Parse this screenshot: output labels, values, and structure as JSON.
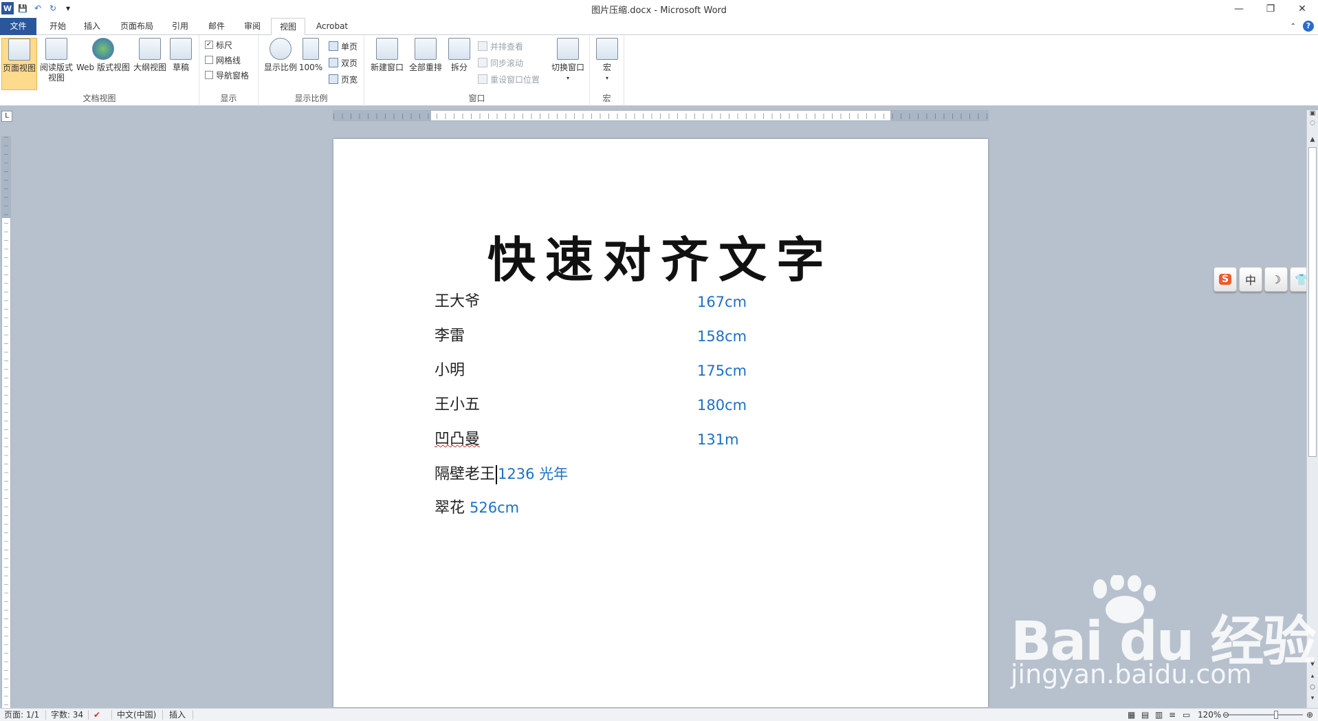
{
  "window": {
    "title": "图片压缩.docx - Microsoft Word",
    "minimize": "—",
    "restore": "❐",
    "close": "✕"
  },
  "qat": {
    "word_icon": "W",
    "save_icon": "💾",
    "undo_icon": "↶",
    "redo_icon": "↻",
    "customize_icon": "▾"
  },
  "tabs": [
    "文件",
    "开始",
    "插入",
    "页面布局",
    "引用",
    "邮件",
    "审阅",
    "视图",
    "Acrobat"
  ],
  "ribbon": {
    "doc_views": {
      "label": "文档视图",
      "print_layout": "页面视图",
      "full_screen_reading": "阅读版式\n视图",
      "web_layout": "Web 版式视图",
      "outline": "大纲视图",
      "draft": "草稿"
    },
    "show": {
      "label": "显示",
      "ruler": "标尺",
      "gridlines": "网格线",
      "nav_pane": "导航窗格"
    },
    "zoom": {
      "label": "显示比例",
      "zoom": "显示比例",
      "hundred": "100%",
      "one_page": "单页",
      "two_pages": "双页",
      "page_width": "页宽"
    },
    "window": {
      "label": "窗口",
      "new_window": "新建窗口",
      "arrange_all": "全部重排",
      "split": "拆分",
      "side_by_side": "并排查看",
      "sync_scroll": "同步滚动",
      "reset_position": "重设窗口位置",
      "switch_windows": "切换窗口"
    },
    "macros": {
      "label": "宏",
      "macros": "宏"
    }
  },
  "document": {
    "title": "快速对齐文字",
    "rows": [
      {
        "name": "王大爷",
        "value": "167cm"
      },
      {
        "name": "李雷",
        "value": "158cm"
      },
      {
        "name": "小明",
        "value": "175cm"
      },
      {
        "name": "王小五",
        "value": "180cm"
      },
      {
        "name": "凹凸曼",
        "value": "131m"
      }
    ],
    "row6_name": "隔壁老王",
    "row6_value": "1236 光年",
    "row7_name": "翠花",
    "row7_value": "526cm"
  },
  "ime": {
    "logo": "S",
    "mode": "中",
    "moon": "☽",
    "skin": "👕"
  },
  "watermark": {
    "brand": "Bai du 经验",
    "url": "jingyan.baidu.com"
  },
  "status": {
    "page": "页面: 1/1",
    "words": "字数: 34",
    "language": "中文(中国)",
    "mode": "插入",
    "zoom": "120%"
  }
}
